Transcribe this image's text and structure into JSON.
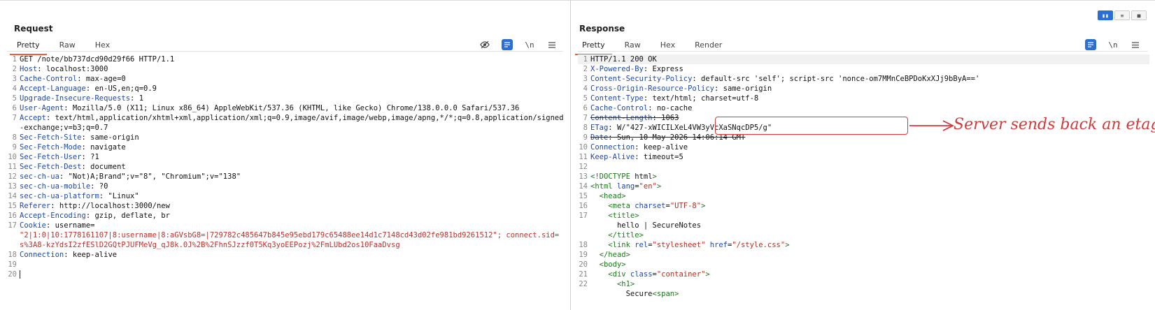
{
  "request": {
    "title": "Request",
    "tabs": [
      "Pretty",
      "Raw",
      "Hex"
    ],
    "tools": {
      "newline_label": "\\n"
    },
    "lines": [
      {
        "n": "1",
        "k": "",
        "v": "GET /note/bb737dcd90d29f66 HTTP/1.1"
      },
      {
        "n": "2",
        "k": "Host",
        "v": " localhost:3000"
      },
      {
        "n": "3",
        "k": "Cache-Control",
        "v": " max-age=0"
      },
      {
        "n": "4",
        "k": "Accept-Language",
        "v": " en-US,en;q=0.9"
      },
      {
        "n": "5",
        "k": "Upgrade-Insecure-Requests",
        "v": " 1"
      },
      {
        "n": "6",
        "k": "User-Agent",
        "v": " Mozilla/5.0 (X11; Linux x86_64) AppleWebKit/537.36 (KHTML, like Gecko) Chrome/138.0.0.0 Safari/537.36"
      },
      {
        "n": "7",
        "k": "Accept",
        "v": " text/html,application/xhtml+xml,application/xml;q=0.9,image/avif,image/webp,image/apng,*/*;q=0.8,application/signed-exchange;v=b3;q=0.7"
      },
      {
        "n": "8",
        "k": "Sec-Fetch-Site",
        "v": " same-origin"
      },
      {
        "n": "9",
        "k": "Sec-Fetch-Mode",
        "v": " navigate"
      },
      {
        "n": "10",
        "k": "Sec-Fetch-User",
        "v": " ?1"
      },
      {
        "n": "11",
        "k": "Sec-Fetch-Dest",
        "v": " document"
      },
      {
        "n": "12",
        "k": "sec-ch-ua",
        "v": " \"Not)A;Brand\";v=\"8\", \"Chromium\";v=\"138\""
      },
      {
        "n": "13",
        "k": "sec-ch-ua-mobile",
        "v": " ?0"
      },
      {
        "n": "14",
        "k": "sec-ch-ua-platform",
        "v": " \"Linux\""
      },
      {
        "n": "15",
        "k": "Referer",
        "v": " http://localhost:3000/new"
      },
      {
        "n": "16",
        "k": "Accept-Encoding",
        "v": " gzip, deflate, br"
      },
      {
        "n": "17",
        "k": "Cookie",
        "v": " username=",
        "red": "\"2|1:0|10:1778161107|8:username|8:aGVsbG8=|729782c485647b845e95ebd179c65488ee14d1c7148cd43d02fe981bd9261512\"; connect.sid=s%3A8-kzYdsI2zfESlD2GQtPJUFMeVg_qJ8k.0J%2B%2FhnSJzzf0T5Kq3yoEEPozj%2FmLUbd2os10FaaDvsg"
      },
      {
        "n": "18",
        "k": "Connection",
        "v": " keep-alive"
      },
      {
        "n": "19",
        "k": "",
        "v": ""
      },
      {
        "n": "20",
        "k": "",
        "v": ""
      }
    ]
  },
  "response": {
    "title": "Response",
    "tabs": [
      "Pretty",
      "Raw",
      "Hex",
      "Render"
    ],
    "tools": {
      "newline_label": "\\n"
    },
    "headers": [
      {
        "n": "1",
        "k": "",
        "v": "HTTP/1.1 200 OK"
      },
      {
        "n": "2",
        "k": "X-Powered-By",
        "v": " Express"
      },
      {
        "n": "3",
        "k": "Content-Security-Policy",
        "v": " default-src 'self'; script-src 'nonce-om7MMnCeBPDoKxXJj9bByA=='"
      },
      {
        "n": "4",
        "k": "Cross-Origin-Resource-Policy",
        "v": " same-origin"
      },
      {
        "n": "5",
        "k": "Content-Type",
        "v": " text/html; charset=utf-8"
      },
      {
        "n": "6",
        "k": "Cache-Control",
        "v": " no-cache"
      },
      {
        "n": "7",
        "k": "Content-Length",
        "v": " 1063"
      },
      {
        "n": "8",
        "k": "ETag",
        "v": " W/\"427-xWICILXeL4VW3yVcXaSNqcDP5/g\""
      },
      {
        "n": "9",
        "k": "Date",
        "v": " Sun, 10 May 2026 14:06:14 GMT"
      },
      {
        "n": "10",
        "k": "Connection",
        "v": " keep-alive"
      },
      {
        "n": "11",
        "k": "Keep-Alive",
        "v": " timeout=5"
      },
      {
        "n": "12",
        "k": "",
        "v": ""
      }
    ],
    "html_lines": [
      {
        "n": "13",
        "t": "<!DOCTYPE html>"
      },
      {
        "n": "14",
        "t": "<html lang=\"en\">"
      },
      {
        "n": "15",
        "t": "  <head>"
      },
      {
        "n": "16",
        "t": "    <meta charset=\"UTF-8\">"
      },
      {
        "n": "17",
        "t": "    <title>"
      },
      {
        "n": "",
        "t": "      hello | SecureNotes"
      },
      {
        "n": "",
        "t": "    </title>"
      },
      {
        "n": "18",
        "t": "    <link rel=\"stylesheet\" href=\"/style.css\">"
      },
      {
        "n": "19",
        "t": "  </head>"
      },
      {
        "n": "20",
        "t": "  <body>"
      },
      {
        "n": "21",
        "t": "    <div class=\"container\">"
      },
      {
        "n": "22",
        "t": "      <h1>"
      },
      {
        "n": "",
        "t": "        Secure<span>"
      }
    ]
  },
  "annotation": {
    "text": "Server sends back an etag",
    "color": "#d23a3a"
  }
}
